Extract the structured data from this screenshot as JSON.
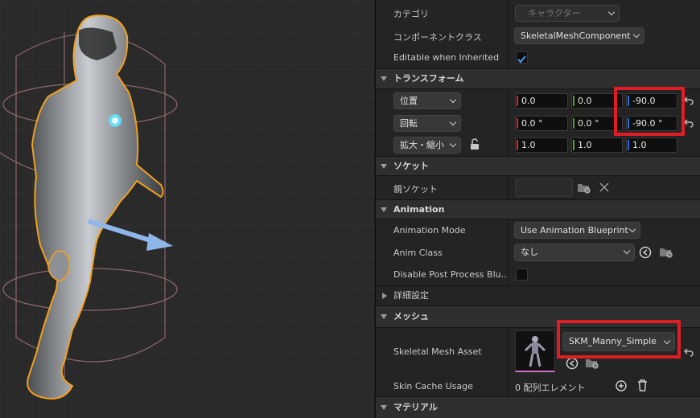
{
  "details": {
    "category_label": "カテゴリ",
    "category_value": "キャラクター",
    "component_class_label": "コンポーネントクラス",
    "component_class_value": "SkeletalMeshComponent",
    "editable_label": "Editable when Inherited",
    "editable_checked": true
  },
  "transform": {
    "section_title": "トランスフォーム",
    "location_label": "位置",
    "location": {
      "x": "0.0",
      "y": "0.0",
      "z": "-90.0"
    },
    "rotation_label": "回転",
    "rotation": {
      "x": "0.0 °",
      "y": "0.0 °",
      "z": "-90.0 °"
    },
    "scale_label": "拡大・縮小",
    "scale": {
      "x": "1.0",
      "y": "1.0",
      "z": "1.0"
    }
  },
  "socket": {
    "section_title": "ソケット",
    "parent_socket_label": "親ソケット"
  },
  "animation": {
    "section_title": "Animation",
    "mode_label": "Animation Mode",
    "mode_value": "Use Animation Blueprint",
    "anim_class_label": "Anim Class",
    "anim_class_value": "なし",
    "disable_pp_label": "Disable Post Process Blu..."
  },
  "advanced": {
    "section_title": "詳細設定"
  },
  "mesh": {
    "section_title": "メッシュ",
    "asset_label": "Skeletal Mesh Asset",
    "asset_value": "SKM_Manny_Simple",
    "skin_cache_label": "Skin Cache Usage",
    "skin_cache_value": "0 配列エレメント"
  },
  "material": {
    "section_title": "マテリアル"
  },
  "colors": {
    "highlight": "#e01c24",
    "selection_outline": "#f0a020",
    "x_axis": "#c83030",
    "y_axis": "#5ca02a",
    "z_axis": "#2e6ed6"
  }
}
